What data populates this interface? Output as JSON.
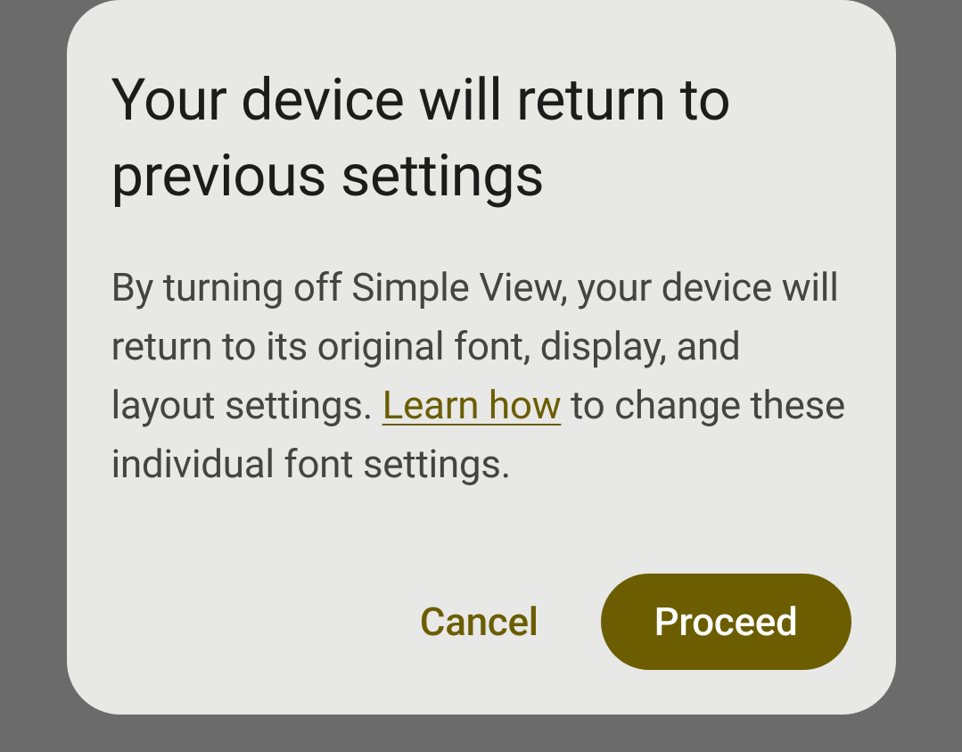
{
  "dialog": {
    "title": "Your device will return to previous settings",
    "body_part1": "By turning off Simple View, your device will return to its original font, display, and layout settings. ",
    "link_text": "Learn how",
    "body_part2": " to change these individual font settings.",
    "cancel_label": "Cancel",
    "proceed_label": "Proceed"
  }
}
